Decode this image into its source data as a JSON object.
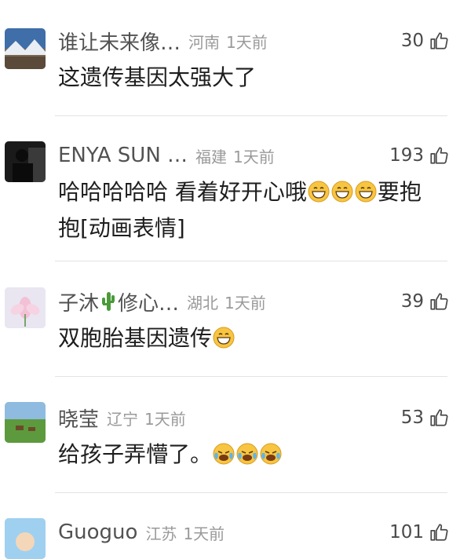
{
  "comments": [
    {
      "username": "谁让未来像…",
      "location": "河南",
      "time": "1天前",
      "likes": "30",
      "text": "这遗传基因太强大了",
      "emojis": []
    },
    {
      "username": "ENYA  SUN  …",
      "location": "福建",
      "time": "1天前",
      "likes": "193",
      "text_line1": "哈哈哈哈哈 看着好开心哦",
      "text_line1_after": "要抱",
      "text_line2": "抱[动画表情]",
      "emojis": [
        "grin-emoji",
        "grin-emoji",
        "grin-emoji"
      ]
    },
    {
      "username": "子沐",
      "username_suffix": "修心…",
      "location": "湖北",
      "time": "1天前",
      "likes": "39",
      "text": "双胞胎基因遗传",
      "emojis": [
        "grin-emoji"
      ]
    },
    {
      "username": "晓莹",
      "location": "辽宁",
      "time": "1天前",
      "likes": "53",
      "text": "给孩子弄懵了。",
      "emojis": [
        "crying-laugh-emoji",
        "crying-laugh-emoji",
        "crying-laugh-emoji"
      ]
    },
    {
      "username": "Guoguo",
      "location": "江苏",
      "time": "1天前",
      "likes": "101"
    }
  ]
}
